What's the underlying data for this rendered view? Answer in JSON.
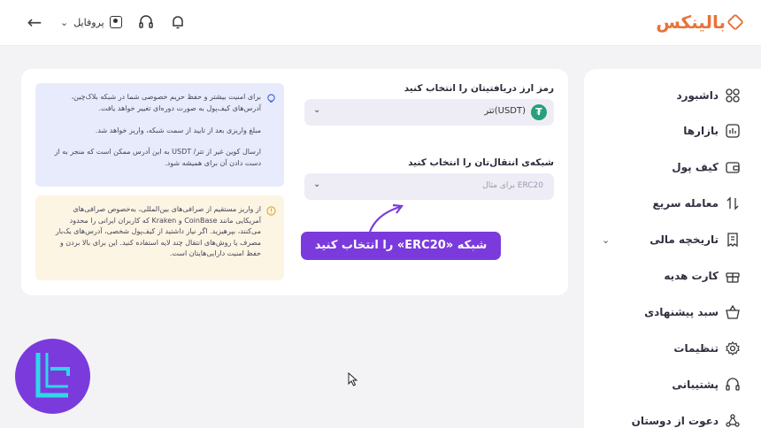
{
  "app": {
    "brand_name": "بالینکس"
  },
  "header": {
    "profile_label": "پروفایل"
  },
  "sidebar": {
    "items": [
      {
        "label": "داشبورد",
        "icon": "dashboard-icon"
      },
      {
        "label": "بازارها",
        "icon": "markets-icon"
      },
      {
        "label": "کیف پول",
        "icon": "wallet-icon"
      },
      {
        "label": "معامله سریع",
        "icon": "swap-icon"
      },
      {
        "label": "تاریخچه مالی",
        "icon": "history-icon"
      },
      {
        "label": "کارت هدیه",
        "icon": "gift-icon"
      },
      {
        "label": "سبد پیشنهادی",
        "icon": "basket-icon"
      },
      {
        "label": "تنظیمات",
        "icon": "gear-icon"
      },
      {
        "label": "پشتیبانی",
        "icon": "headset-icon"
      },
      {
        "label": "دعوت از دوستان",
        "icon": "invite-icon"
      }
    ]
  },
  "deposit": {
    "currency_label": "رمز ارز دریافتیتان را انتخاب کنید",
    "currency_value": "تتر(USDT)",
    "network_label": "شبکه‌ی انتقال‌تان را انتخاب کنید",
    "network_placeholder": "برای مثال ERC20"
  },
  "info": {
    "p1": "برای امنیت بیشتر و حفظ حریم خصوصی شما در شبکه بلاک‌چین، آدرس‌های کیف‌پول به صورت دوره‌ای تغییر خواهد یافت.",
    "p2": "مبلغ واریزی بعد از تایید از سمت شبکه، واریز خواهد شد.",
    "p3": "ارسال کوین غیر از تتر/ USDT به این آدرس ممکن است که منجر به از دست دادن آن برای همیشه شود."
  },
  "warning": {
    "text": "از واریز مستقیم از صرافی‌های بین‌المللی، به‌خصوص صرافی‌های آمریکایی مانند CoinBase و Kraken که کاربران ایرانی را محدود می‌کنند، بپرهیزید. اگر نیاز داشتید از کیف‌پول شخصی، آدرس‌های یک‌بار مصرف یا روش‌های انتقال چند لایه استفاده کنید. این برای بالا بردن و حفظ امنیت دارایی‌هایتان است."
  },
  "annotation": {
    "text": "شبکه «ERC20» را انتخاب کنید"
  },
  "colors": {
    "accent": "#7b3bdc",
    "brand": "#e8733a",
    "tether": "#26a17b",
    "info_bg": "#e8ebfc",
    "warning_bg": "#fdf5e3"
  }
}
